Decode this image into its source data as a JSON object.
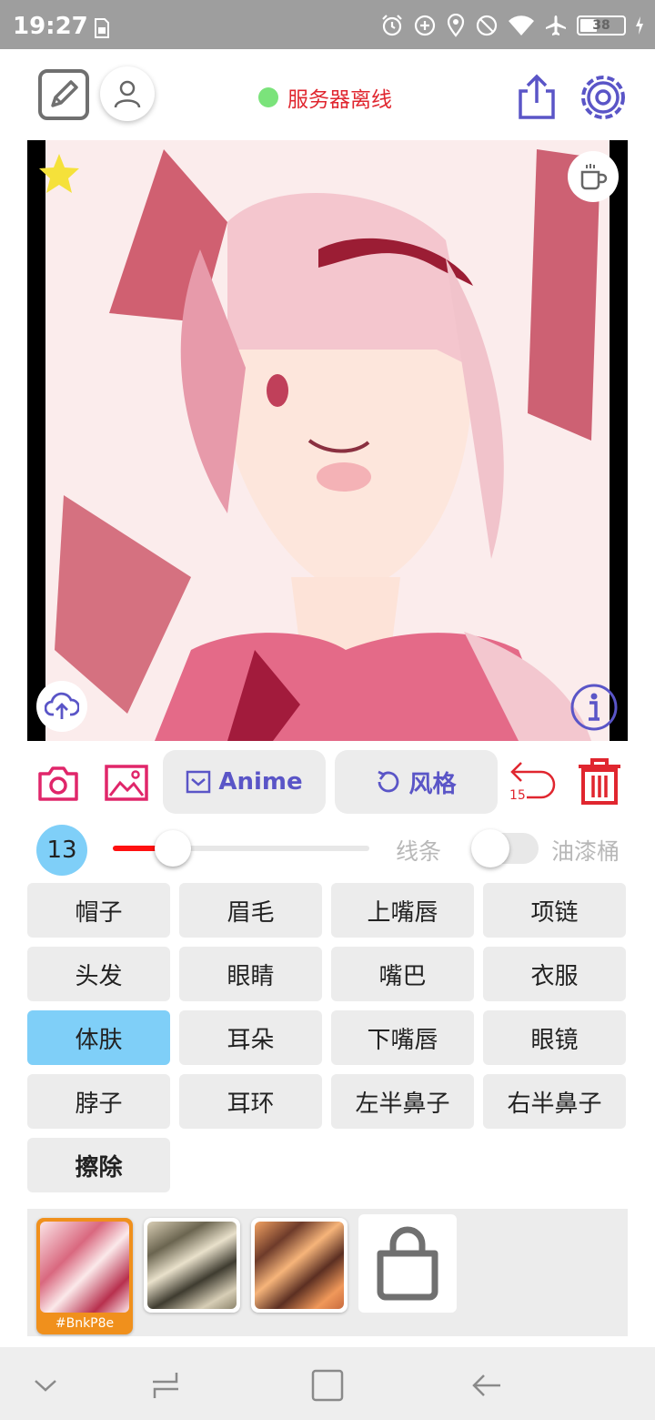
{
  "status_bar": {
    "time": "19:27",
    "battery": "38",
    "icons": [
      "sim-icon",
      "alarm-icon",
      "data-saver-icon",
      "location-icon",
      "do-not-disturb-icon",
      "wifi-icon",
      "airplane-icon",
      "battery-icon",
      "charging-icon"
    ]
  },
  "topbar": {
    "server_status": "服务器离线",
    "server_status_color": "#e0262f",
    "status_dot_color": "#7be37b",
    "icons": [
      "edit-icon",
      "user-icon",
      "share-icon",
      "settings-icon"
    ]
  },
  "canvas": {
    "icons": [
      "star-icon",
      "coffee-cup-icon",
      "cloud-upload-icon",
      "info-icon"
    ]
  },
  "actions": {
    "anime_label": "Anime",
    "style_label": "风格",
    "undo_count": "15",
    "icons": [
      "camera-icon",
      "image-icon",
      "envelope-icon",
      "refresh-icon",
      "undo-icon",
      "trash-icon"
    ]
  },
  "brush": {
    "size": "13",
    "slider_fraction": 0.23,
    "line_label": "线条",
    "bucket_label": "油漆桶",
    "bucket_enabled": false
  },
  "labels": [
    "帽子",
    "眉毛",
    "上嘴唇",
    "项链",
    "头发",
    "眼睛",
    "嘴巴",
    "衣服",
    "体肤",
    "耳朵",
    "下嘴唇",
    "眼镜",
    "脖子",
    "耳环",
    "左半鼻子",
    "右半鼻子",
    "擦除"
  ],
  "selected_label": "体肤",
  "styles": {
    "selected_code": "#BnkP8e",
    "icons": [
      "shopping-bag-icon"
    ]
  },
  "colors": {
    "accent_blue": "#5a55c7",
    "accent_red": "#e0262f",
    "selected_chip": "#7fcff8",
    "selected_style": "#f0901c"
  },
  "navbar": {
    "icons": [
      "chevron-down-icon",
      "recent-apps-icon",
      "home-icon",
      "back-icon"
    ]
  }
}
